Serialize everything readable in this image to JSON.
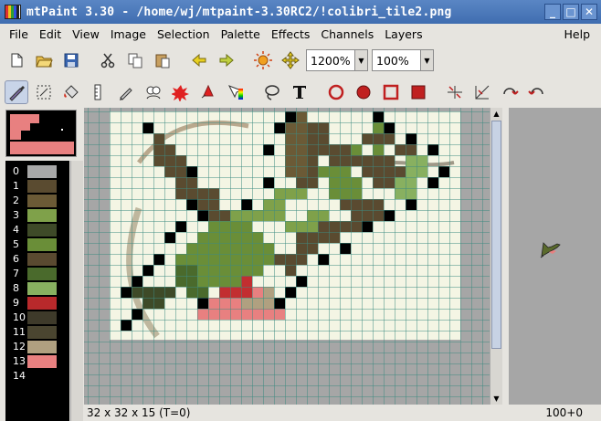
{
  "window": {
    "title": "mtPaint 3.30 - /home/wj/mtpaint-3.30RC2/!colibri_tile2.png",
    "buttons": [
      "_",
      "□",
      "✕"
    ]
  },
  "menu": [
    "File",
    "Edit",
    "View",
    "Image",
    "Selection",
    "Palette",
    "Effects",
    "Channels",
    "Layers",
    "Help"
  ],
  "toolbar": {
    "zoom": "1200%",
    "opacity": "100%"
  },
  "palette": {
    "indices": [
      "0",
      "1",
      "2",
      "3",
      "4",
      "5",
      "6",
      "7",
      "8",
      "9",
      "10",
      "11",
      "12",
      "13",
      "14"
    ],
    "colors": [
      "#a8a8a8",
      "#5a4b30",
      "#6b5a36",
      "#7fa14a",
      "#3e4a28",
      "#6a8e38",
      "#5a4a30",
      "#4a6a2c",
      "#88b060",
      "#b8292b",
      "#3e3a2a",
      "#4a4530",
      "#b0a080",
      "#e88080",
      "#000000"
    ]
  },
  "status": {
    "size": "32 x 32 x 15  (T=0)",
    "coords": "100+0"
  }
}
